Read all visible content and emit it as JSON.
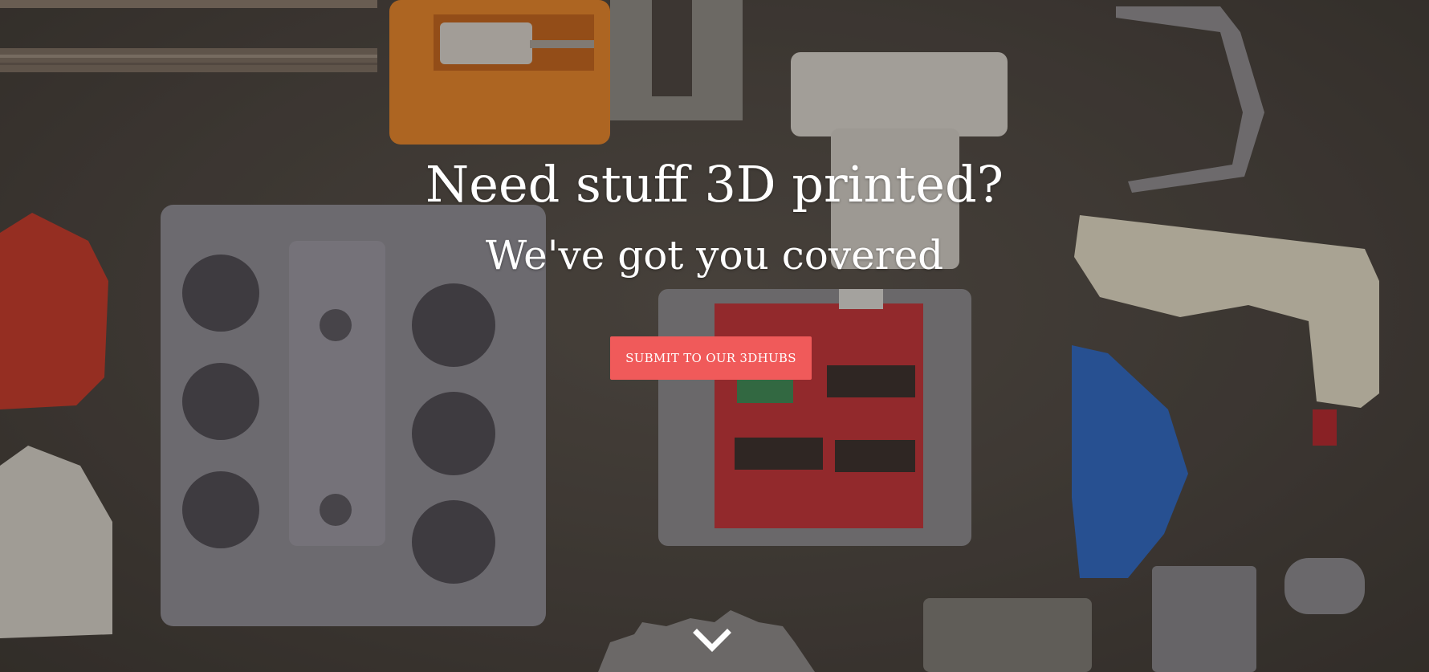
{
  "hero": {
    "headline": "Need stuff 3D printed?",
    "subheadline": "We've got you covered",
    "cta_label": "SUBMIT TO OUR 3DHUBS",
    "scroll_icon": "chevron-down-icon"
  },
  "colors": {
    "accent": "#f05a5a",
    "text": "#ffffff",
    "background": "#4a4540"
  }
}
